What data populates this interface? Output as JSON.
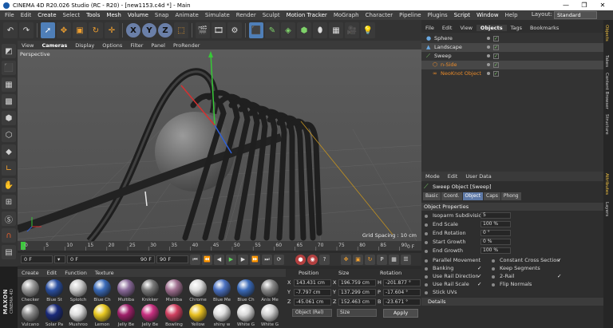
{
  "window": {
    "title": "CINEMA 4D R20.026 Studio (RC - R20) - [new1153.c4d *] - Main",
    "controls": [
      "—",
      "❐",
      "✕"
    ]
  },
  "menubar": {
    "items": [
      "File",
      "Edit",
      "Create",
      "Select",
      "Tools",
      "Mesh",
      "Volume",
      "Snap",
      "Animate",
      "Simulate",
      "Render",
      "Sculpt",
      "Motion Tracker",
      "MoGraph",
      "Character",
      "Pipeline",
      "Plugins",
      "Script",
      "Window",
      "Help"
    ],
    "layout_label": "Layout:",
    "layout_value": "Standard"
  },
  "toolbar": {
    "axis_buttons": [
      "X",
      "Y",
      "Z"
    ]
  },
  "viewport": {
    "menu": [
      "View",
      "Cameras",
      "Display",
      "Options",
      "Filter",
      "Panel",
      "ProRender"
    ],
    "camera_label": "Perspective",
    "grid_spacing": "Grid Spacing : 10 cm"
  },
  "timeline": {
    "ticks": [
      "0",
      "5",
      "10",
      "15",
      "20",
      "25",
      "30",
      "35",
      "40",
      "45",
      "50",
      "55",
      "60",
      "65",
      "70",
      "75",
      "80",
      "85",
      "90"
    ],
    "end_label": "0 F"
  },
  "transport": {
    "current_frame": "0 F",
    "start_frame": "0 F",
    "end_field": "90 F",
    "max_frame": "90 F"
  },
  "materials": {
    "menu": [
      "Create",
      "Edit",
      "Function",
      "Texture"
    ],
    "row1": [
      {
        "label": "Checker",
        "color": "#9a9a9a"
      },
      {
        "label": "Blue St",
        "color": "#2a4fa0"
      },
      {
        "label": "Splotch",
        "color": "#c9c9c9"
      },
      {
        "label": "Blue Ch",
        "color": "#3a6ab8"
      },
      {
        "label": "Multiba",
        "color": "#8a6a9a"
      },
      {
        "label": "Knikker",
        "color": "#7a7a7a"
      },
      {
        "label": "Multiba",
        "color": "#a07090"
      },
      {
        "label": "Chrome",
        "color": "#dcdcdc"
      },
      {
        "label": "Blue Me",
        "color": "#4a70c0"
      },
      {
        "label": "Blue Ch",
        "color": "#3a6ab8"
      },
      {
        "label": "Anis Me",
        "color": "#8a8a8a"
      }
    ],
    "row2": [
      {
        "label": "Vulcano",
        "color": "#8a8a8a"
      },
      {
        "label": "Solar Pa",
        "color": "#1a2a7a"
      },
      {
        "label": "Mushroo",
        "color": "#dedede"
      },
      {
        "label": "Lemon",
        "color": "#e8c820"
      },
      {
        "label": "Jelly Be",
        "color": "#a0206a"
      },
      {
        "label": "Jelly Be",
        "color": "#c83080"
      },
      {
        "label": "Bowling",
        "color": "#d04060"
      },
      {
        "label": "Yellow",
        "color": "#e8c020"
      },
      {
        "label": "shiny w",
        "color": "#e0e0e0"
      },
      {
        "label": "White G",
        "color": "#dadada"
      },
      {
        "label": "White G",
        "color": "#d0d0d0"
      }
    ]
  },
  "coords": {
    "headers": [
      "Position",
      "Size",
      "Rotation"
    ],
    "rows": [
      {
        "axis": "X",
        "pos": "143.431 cm",
        "size": "196.759 cm",
        "rlabel": "H",
        "rot": "-201.877 °"
      },
      {
        "axis": "Y",
        "pos": "-7.797 cm",
        "size": "137.299 cm",
        "rlabel": "P",
        "rot": "-17.604 °"
      },
      {
        "axis": "Z",
        "pos": "-45.061 cm",
        "size": "152.463 cm",
        "rlabel": "B",
        "rot": "-23.671 °"
      }
    ],
    "mode_select": "Object (Rel)",
    "size_select": "Size",
    "apply": "Apply"
  },
  "object_manager": {
    "menu": [
      "File",
      "Edit",
      "View",
      "Objects",
      "Tags",
      "Bookmarks"
    ],
    "objects": [
      {
        "name": "Sphere",
        "indent": 0,
        "icon": "sphere-icon",
        "orange": false
      },
      {
        "name": "Landscape",
        "indent": 0,
        "icon": "landscape-icon",
        "orange": false
      },
      {
        "name": "Sweep",
        "indent": 0,
        "icon": "sweep-icon",
        "orange": false
      },
      {
        "name": "n-Side",
        "indent": 1,
        "icon": "nside-icon",
        "orange": true
      },
      {
        "name": "NeoKnot Object",
        "indent": 1,
        "icon": "knot-icon",
        "orange": true
      }
    ]
  },
  "attributes": {
    "menu": [
      "Mode",
      "Edit",
      "User Data"
    ],
    "title": "Sweep Object [Sweep]",
    "tabs": [
      "Basic",
      "Coord.",
      "Object",
      "Caps",
      "Phong"
    ],
    "active_tab": "Object",
    "section": "Object Properties",
    "props": [
      {
        "label": "Isoparm Subdivision",
        "value": "5"
      },
      {
        "label": "End Scale",
        "value": "100 %"
      },
      {
        "label": "End Rotation",
        "value": "0 °"
      },
      {
        "label": "Start Growth",
        "value": "0 %"
      },
      {
        "label": "End Growth",
        "value": "100 %"
      }
    ],
    "checks_left": [
      {
        "label": "Parallel Movement",
        "checked": false
      },
      {
        "label": "Banking",
        "checked": true
      },
      {
        "label": "Use Rail Direction",
        "checked": true
      },
      {
        "label": "Use Rail Scale",
        "checked": true
      },
      {
        "label": "Stick UVs",
        "checked": false
      }
    ],
    "checks_right": [
      {
        "label": "Constant Cross Section",
        "checked": true
      },
      {
        "label": "Keep Segments",
        "checked": false
      },
      {
        "label": "2-Rail",
        "checked": true
      },
      {
        "label": "Flip Normals",
        "checked": false
      }
    ],
    "details": "Details"
  },
  "side_tabs": [
    "Objects",
    "Takes",
    "Content Browser",
    "Structure",
    "Attributes",
    "Layers"
  ]
}
